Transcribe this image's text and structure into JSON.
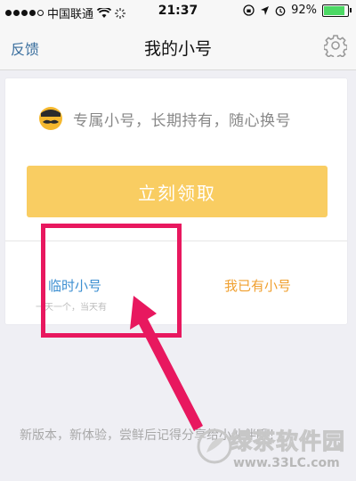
{
  "status": {
    "carrier": "中国联通",
    "time": "21:37",
    "battery": "92%",
    "battery_level": 0.92
  },
  "nav": {
    "back_label": "反馈",
    "title": "我的小号",
    "settings_icon": "gear-icon"
  },
  "card": {
    "promo_text": "专属小号，长期持有，随心换号",
    "claim_button": "立刻领取",
    "option_temp": "临时小号",
    "option_temp_sub": "一天一个，当天有",
    "option_have": "我已有小号"
  },
  "footer": {
    "text": "新版本，新体验，尝鲜后记得分享给小伙伴哦！"
  },
  "watermark": {
    "name": "绿茶软件园",
    "url": "www.33LC.com"
  },
  "colors": {
    "accent_blue": "#3d8fd1",
    "accent_orange": "#f0a030",
    "button_yellow": "#f9cd62",
    "highlight_red": "#e8185f"
  }
}
